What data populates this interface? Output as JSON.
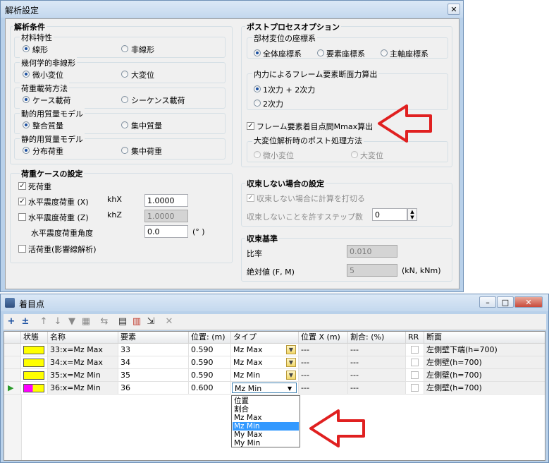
{
  "dialog": {
    "title": "解析設定",
    "close_label": "✕",
    "analysis": {
      "title": "解析条件",
      "material": {
        "title": "材料特性",
        "opt1": "線形",
        "opt2": "非線形",
        "selected": "線形"
      },
      "geom": {
        "title": "幾何学的非線形",
        "opt1": "微小変位",
        "opt2": "大変位",
        "selected": "微小変位"
      },
      "loading": {
        "title": "荷重載荷方法",
        "opt1": "ケース載荷",
        "opt2": "シーケンス載荷",
        "selected": "ケース載荷"
      },
      "mass": {
        "title": "動的用質量モデル",
        "opt1": "整合質量",
        "opt2": "集中質量",
        "selected": "整合質量"
      },
      "static_mass": {
        "title": "静的用質量モデル",
        "opt1": "分布荷重",
        "opt2": "集中荷重",
        "selected": "分布荷重"
      }
    },
    "load_case": {
      "title": "荷重ケースの設定",
      "dead": {
        "label": "死荷重",
        "checked": true
      },
      "hx": {
        "label": "水平震度荷重 (X)",
        "coef": "khX",
        "value": "1.0000",
        "checked": true
      },
      "hz": {
        "label": "水平震度荷重 (Z)",
        "coef": "khZ",
        "value": "1.0000",
        "checked": false
      },
      "angle": {
        "label": "水平震度荷重角度",
        "value": "0.0",
        "unit": "(° )"
      },
      "live": {
        "label": "活荷重(影響線解析)",
        "checked": false
      }
    },
    "post": {
      "title": "ポストプロセスオプション",
      "coord": {
        "title": "部材変位の座標系",
        "opt1": "全体座標系",
        "opt2": "要素座標系",
        "opt3": "主軸座標系",
        "selected": "全体座標系"
      },
      "internal": {
        "title": "内力によるフレーム要素断面力算出",
        "opt1": "1次力 + 2次力",
        "opt2": "2次力",
        "selected": "1次力 + 2次力"
      },
      "mmax": {
        "label": "フレーム要素着目点間Mmax算出",
        "checked": true
      },
      "large": {
        "title": "大変位解析時のポスト処理方法",
        "opt1": "微小変位",
        "opt2": "大変位",
        "selected": "微小変位"
      }
    },
    "nonconv": {
      "title": "収束しない場合の設定",
      "stop_label": "収束しない場合に計算を打切る",
      "stop_checked": true,
      "steps_label": "収束しないことを許すステップ数",
      "steps_value": "0"
    },
    "criteria": {
      "title": "収束基準",
      "ratio_label": "比率",
      "ratio_value": "0.010",
      "abs_label": "絶対値 (F, M)",
      "abs_value": "5",
      "abs_unit": "(kN, kNm)"
    }
  },
  "window": {
    "title": "着目点",
    "minimize": "–",
    "maximize": "□",
    "close": "✕",
    "toolbar": [
      "+",
      "±",
      "↑",
      "↓",
      "▼",
      "▦",
      "⇆",
      "▤",
      "▥",
      "⇲",
      "✕"
    ],
    "columns": [
      "状態",
      "名称",
      "要素",
      "位置: (m)",
      "タイプ",
      "位置 X (m)",
      "割合: (%)",
      "RR",
      "断面"
    ],
    "rows": [
      {
        "color": "#ffff00",
        "name": "33:x=Mz Max",
        "elem": "33",
        "pos": "0.590",
        "type": "Mz Max",
        "posx": "---",
        "ratio": "---",
        "section": "左側壁下端(h=700)",
        "active": false
      },
      {
        "color": "#ffff00",
        "name": "34:x=Mz Max",
        "elem": "34",
        "pos": "0.590",
        "type": "Mz Max",
        "posx": "---",
        "ratio": "---",
        "section": "左側壁(h=700)",
        "active": false
      },
      {
        "color": "#ffff00",
        "name": "35:x=Mz Min",
        "elem": "35",
        "pos": "0.590",
        "type": "Mz Min",
        "posx": "---",
        "ratio": "---",
        "section": "左側壁(h=700)",
        "active": false
      },
      {
        "color": "#ff00ff",
        "name": "36:x=Mz Min",
        "elem": "36",
        "pos": "0.600",
        "type": "Mz Min",
        "posx": "---",
        "ratio": "---",
        "section": "左側壁(h=700)",
        "active": true
      }
    ],
    "dropdown": {
      "options": [
        "位置",
        "割合",
        "Mz Max",
        "Mz Min",
        "My Max",
        "My Min"
      ],
      "selected": "Mz Min"
    }
  },
  "colors": {
    "arrow": "#e02020",
    "accent": "#3399ff"
  }
}
